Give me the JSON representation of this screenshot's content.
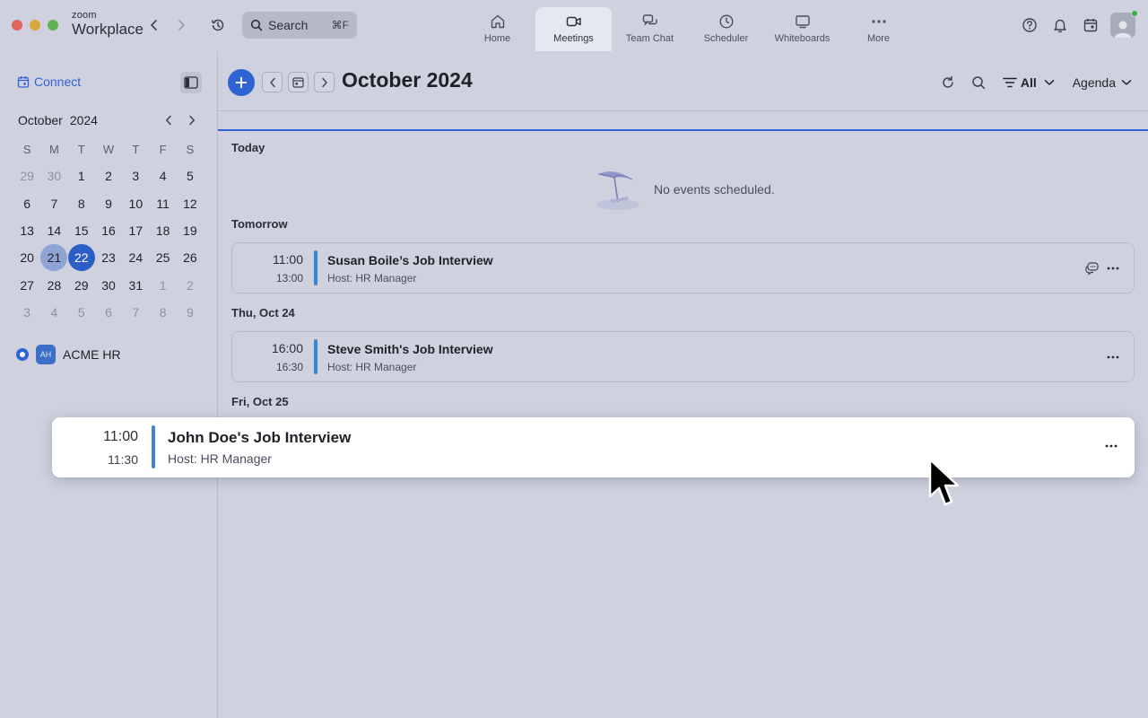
{
  "app": {
    "brand_small": "zoom",
    "brand_name": "Workplace"
  },
  "search": {
    "label": "Search",
    "shortcut": "⌘F"
  },
  "tabs": [
    {
      "label": "Home",
      "icon": "home-icon"
    },
    {
      "label": "Meetings",
      "icon": "video-camera-icon",
      "active": true
    },
    {
      "label": "Team Chat",
      "icon": "chat-bubbles-icon"
    },
    {
      "label": "Scheduler",
      "icon": "clock-icon"
    },
    {
      "label": "Whiteboards",
      "icon": "whiteboard-icon"
    },
    {
      "label": "More",
      "icon": "ellipsis-icon"
    }
  ],
  "sidebar": {
    "connect_label": "Connect",
    "mini_calendar": {
      "month": "October",
      "year": "2024",
      "weekdays": [
        "S",
        "M",
        "T",
        "W",
        "T",
        "F",
        "S"
      ],
      "weeks": [
        [
          "29",
          "30",
          "1",
          "2",
          "3",
          "4",
          "5"
        ],
        [
          "6",
          "7",
          "8",
          "9",
          "10",
          "11",
          "12"
        ],
        [
          "13",
          "14",
          "15",
          "16",
          "17",
          "18",
          "19"
        ],
        [
          "20",
          "21",
          "22",
          "23",
          "24",
          "25",
          "26"
        ],
        [
          "27",
          "28",
          "29",
          "30",
          "31",
          "1",
          "2"
        ],
        [
          "3",
          "4",
          "5",
          "6",
          "7",
          "8",
          "9"
        ]
      ],
      "selected_day": "21",
      "today": "22"
    },
    "calendars": [
      {
        "initials": "AH",
        "name": "ACME HR"
      }
    ]
  },
  "toolbar": {
    "title": "October 2024",
    "filter_label": "All",
    "view_label": "Agenda"
  },
  "agenda": {
    "today_label": "Today",
    "no_events_text": "No events scheduled.",
    "tomorrow_label": "Tomorrow",
    "thu_label": "Thu, Oct 24",
    "fri_label": "Fri, Oct 25",
    "events": [
      {
        "start": "11:00",
        "end": "13:00",
        "title": "Susan Boile’s Job Interview",
        "host": "Host: HR Manager"
      },
      {
        "start": "16:00",
        "end": "16:30",
        "title": "Steve Smith's Job Interview",
        "host": "Host: HR Manager"
      }
    ],
    "dragged_event": {
      "start": "11:00",
      "end": "11:30",
      "title": "John Doe's Job Interview",
      "host": "Host: HR Manager"
    }
  },
  "colors": {
    "accent": "#2f63d4",
    "event_bar": "#3b84d8",
    "today_circle": "#2c5ec8",
    "selected_circle": "#8fa3d4"
  }
}
